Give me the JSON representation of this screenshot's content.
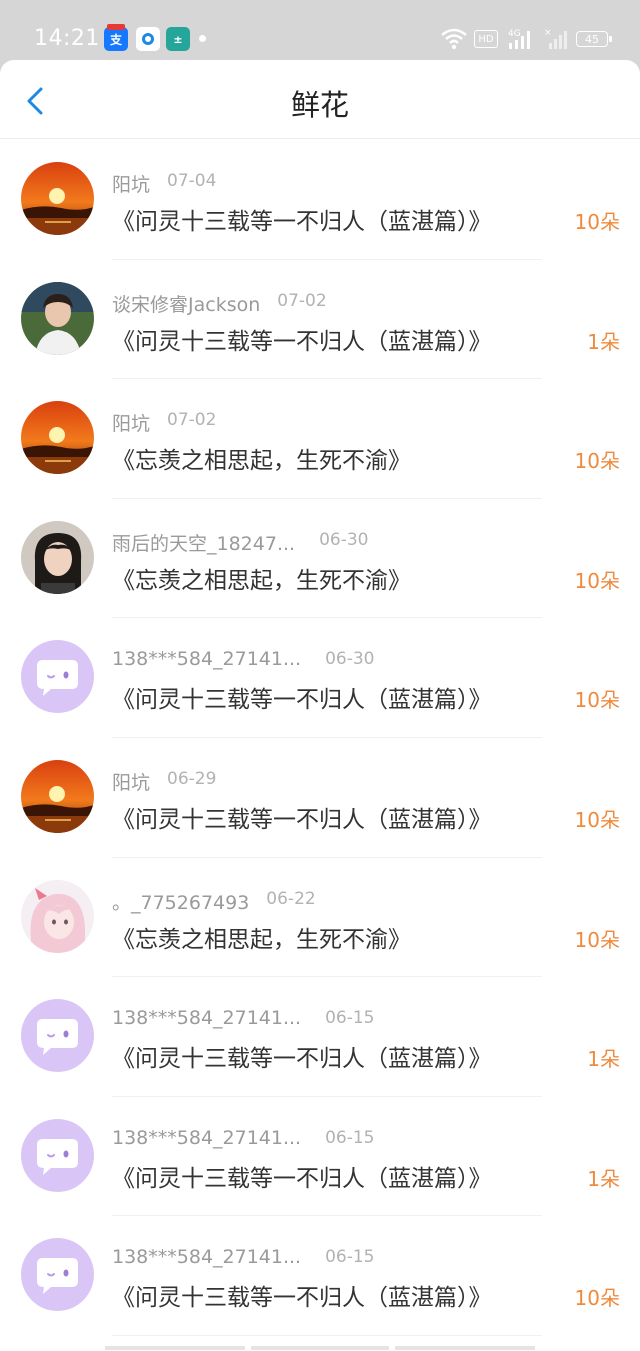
{
  "status_bar": {
    "time": "14:21",
    "battery": "45",
    "network": "4G",
    "hd_label": "HD"
  },
  "header": {
    "title": "鲜花",
    "back_icon": "chevron-left-icon"
  },
  "colors": {
    "accent_blue": "#1e88e5",
    "flower_orange": "#ef8a3c",
    "status_bar_bg": "#d6d6d6"
  },
  "items": [
    {
      "name": "阳坑",
      "date": "07-04",
      "work": "《问灵十三载等一不归人（蓝湛篇）》",
      "flowers": "10朵",
      "avatar": "sunset"
    },
    {
      "name": "谈宋修睿Jackson",
      "date": "07-02",
      "work": "《问灵十三载等一不归人（蓝湛篇）》",
      "flowers": "1朵",
      "avatar": "photo-man"
    },
    {
      "name": "阳坑",
      "date": "07-02",
      "work": "《忘羡之相思起，生死不渝》",
      "flowers": "10朵",
      "avatar": "sunset"
    },
    {
      "name": "雨后的天空_18247...",
      "date": "06-30",
      "work": "《忘羡之相思起，生死不渝》",
      "flowers": "10朵",
      "avatar": "photo-woman"
    },
    {
      "name": "138***584_27141...",
      "date": "06-30",
      "work": "《问灵十三载等一不归人（蓝湛篇）》",
      "flowers": "10朵",
      "avatar": "default"
    },
    {
      "name": "阳坑",
      "date": "06-29",
      "work": "《问灵十三载等一不归人（蓝湛篇）》",
      "flowers": "10朵",
      "avatar": "sunset"
    },
    {
      "name": "。_775267493",
      "date": "06-22",
      "work": "《忘羡之相思起，生死不渝》",
      "flowers": "10朵",
      "avatar": "anime"
    },
    {
      "name": "138***584_27141...",
      "date": "06-15",
      "work": "《问灵十三载等一不归人（蓝湛篇）》",
      "flowers": "1朵",
      "avatar": "default"
    },
    {
      "name": "138***584_27141...",
      "date": "06-15",
      "work": "《问灵十三载等一不归人（蓝湛篇）》",
      "flowers": "1朵",
      "avatar": "default"
    },
    {
      "name": "138***584_27141...",
      "date": "06-15",
      "work": "《问灵十三载等一不归人（蓝湛篇）》",
      "flowers": "10朵",
      "avatar": "default"
    }
  ]
}
